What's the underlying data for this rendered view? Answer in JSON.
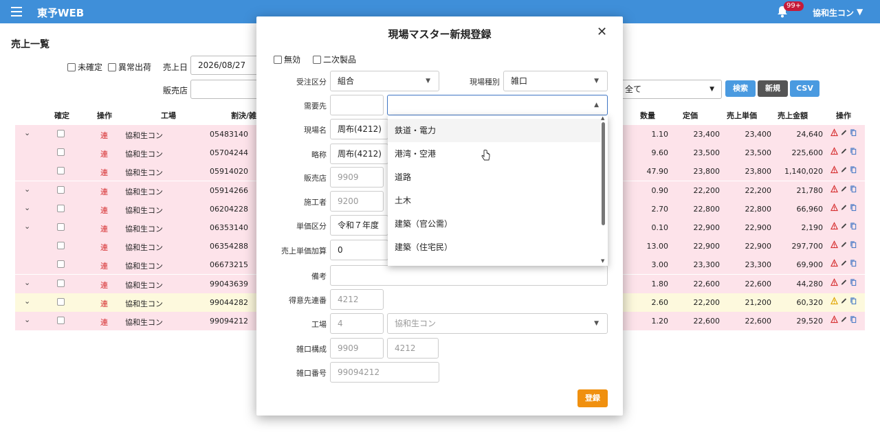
{
  "app": {
    "title": "東予WEB",
    "notification_count": "99+",
    "user": "協和生コン"
  },
  "page": {
    "title": "売上一覧",
    "filters": {
      "unconfirmed": "未確定",
      "abnormal": "異常出荷",
      "date_label": "売上日",
      "date_value": "2026/08/27",
      "dealer_label": "販売店",
      "all_option": "全て"
    },
    "buttons": {
      "search": "検索",
      "new": "新規",
      "csv": "CSV"
    },
    "columns": {
      "confirm": "確定",
      "action": "操作",
      "plant": "工場",
      "split": "割決/雑口",
      "qty": "数量",
      "list_price": "定価",
      "unit_price": "売上単価",
      "amount": "売上金額",
      "ops": "操作"
    },
    "rows": [
      {
        "ren": "連",
        "plant": "協和生コン",
        "code": "05483140",
        "qty": "1.10",
        "list": "23,400",
        "unit": "23,400",
        "amount": "24,640"
      },
      {
        "ren": "連",
        "plant": "協和生コン",
        "code": "05704244",
        "qty": "9.60",
        "list": "23,500",
        "unit": "23,500",
        "amount": "225,600"
      },
      {
        "ren": "連",
        "plant": "協和生コン",
        "code": "05914020",
        "qty": "47.90",
        "list": "23,800",
        "unit": "23,800",
        "amount": "1,140,020"
      },
      {
        "ren": "連",
        "plant": "協和生コン",
        "code": "05914266",
        "qty": "0.90",
        "list": "22,200",
        "unit": "22,200",
        "amount": "21,780"
      },
      {
        "ren": "連",
        "plant": "協和生コン",
        "code": "06204228",
        "qty": "2.70",
        "list": "22,800",
        "unit": "22,800",
        "amount": "66,960"
      },
      {
        "ren": "連",
        "plant": "協和生コン",
        "code": "06353140",
        "qty": "0.10",
        "list": "22,900",
        "unit": "22,900",
        "amount": "2,190"
      },
      {
        "ren": "連",
        "plant": "協和生コン",
        "code": "06354288",
        "qty": "13.00",
        "list": "22,900",
        "unit": "22,900",
        "amount": "297,700"
      },
      {
        "ren": "連",
        "plant": "協和生コン",
        "code": "06673215",
        "qty": "3.00",
        "list": "23,300",
        "unit": "23,300",
        "amount": "69,900"
      },
      {
        "ren": "連",
        "plant": "協和生コン",
        "code": "99043639",
        "qty": "1.80",
        "list": "22,600",
        "unit": "22,600",
        "amount": "44,280"
      },
      {
        "ren": "連",
        "plant": "協和生コン",
        "code": "99044282",
        "qty": "2.60",
        "list": "22,200",
        "unit": "21,200",
        "amount": "60,320"
      },
      {
        "ren": "連",
        "plant": "協和生コン",
        "code": "99094212",
        "qty": "1.20",
        "list": "22,600",
        "unit": "22,600",
        "amount": "29,520"
      }
    ]
  },
  "modal": {
    "title": "現場マスター新規登録",
    "invalid_label": "無効",
    "secondary_label": "二次製品",
    "order_type_label": "受注区分",
    "order_type_value": "組合",
    "site_type_label": "現場種別",
    "site_type_value": "雑口",
    "demand_label": "需要先",
    "site_name_label": "現場名",
    "site_name_value": "周布(4212)",
    "short_label": "略称",
    "short_value": "周布(4212)",
    "dealer_label": "販売店",
    "dealer_value": "9909",
    "builder_label": "施工者",
    "builder_value": "9200",
    "price_cat_label": "単価区分",
    "price_cat_value": "令和７年度",
    "price_add_label": "売上単価加算",
    "price_add_value": "0",
    "note_label": "備考",
    "customer_label": "得意先連番",
    "customer_value": "4212",
    "plant_label": "工場",
    "plant_code": "4",
    "plant_name": "協和生コン",
    "misc_label": "雑口構成",
    "misc_a": "9909",
    "misc_b": "4212",
    "misc_no_label": "雑口番号",
    "misc_no_value": "99094212",
    "register": "登録"
  },
  "dropdown": {
    "options": [
      "鉄道・電力",
      "港湾・空港",
      "道路",
      "土木",
      "建築（官公需）",
      "建築（住宅民）"
    ]
  },
  "colors": {
    "topbar": "#3f8fd9",
    "row_pink": "#fde3ea",
    "row_yellow": "#fdf9dd",
    "register": "#f0900f"
  }
}
